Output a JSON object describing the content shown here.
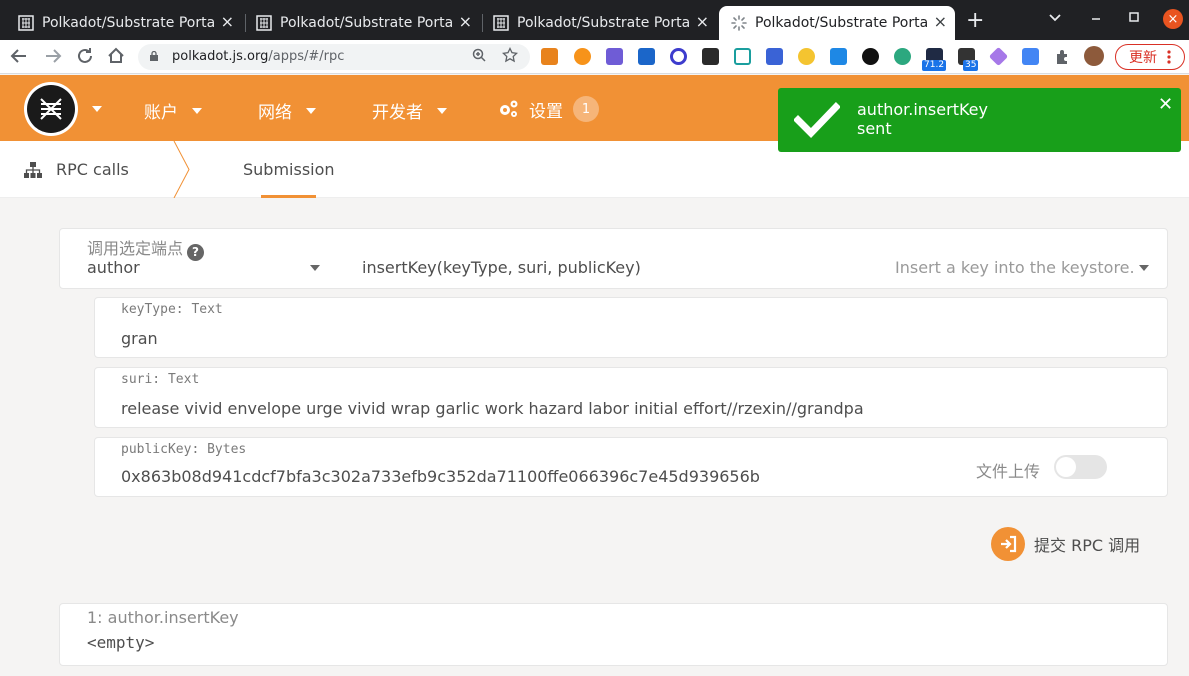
{
  "browser": {
    "tabs": [
      {
        "title": "Polkadot/Substrate Porta"
      },
      {
        "title": "Polkadot/Substrate Porta"
      },
      {
        "title": "Polkadot/Substrate Porta"
      },
      {
        "title": "Polkadot/Substrate Porta"
      }
    ],
    "close_glyph": "×",
    "new_tab_glyph": "+",
    "url_host": "polkadot.js.org",
    "url_path": "/apps/#/rpc",
    "update_label": "更新",
    "ext_badges": [
      "71.2",
      "35"
    ]
  },
  "app": {
    "menu": {
      "accounts": "账户",
      "network": "网络",
      "developer": "开发者",
      "settings": "设置",
      "settings_badge": "1"
    },
    "breadcrumb": {
      "section": "RPC calls",
      "tab": "Submission"
    },
    "toast": {
      "title": "author.insertKey",
      "status": "sent",
      "close": "✕"
    },
    "endpoint": {
      "label": "调用选定端点",
      "help": "?",
      "module": "author",
      "method": "insertKey(keyType, suri, publicKey)",
      "description": "Insert a key into the keystore."
    },
    "params": {
      "keyType_label": "keyType: Text",
      "keyType_value": "gran",
      "suri_label": "suri: Text",
      "suri_value": "release vivid envelope urge vivid wrap garlic work hazard labor initial effort//rzexin//grandpa",
      "publicKey_label": "publicKey: Bytes",
      "publicKey_value": "0x863b08d941cdcf7bfa3c302a733efb9c352da71100ffe066396c7e45d939656b",
      "file_upload_label": "文件上传",
      "file_upload_on": false
    },
    "submit_label": "提交 RPC 调用",
    "result": {
      "title": "1: author.insertKey",
      "value": "<empty>"
    },
    "colors": {
      "accent": "#f19135",
      "toast_bg": "#189f1a"
    }
  }
}
